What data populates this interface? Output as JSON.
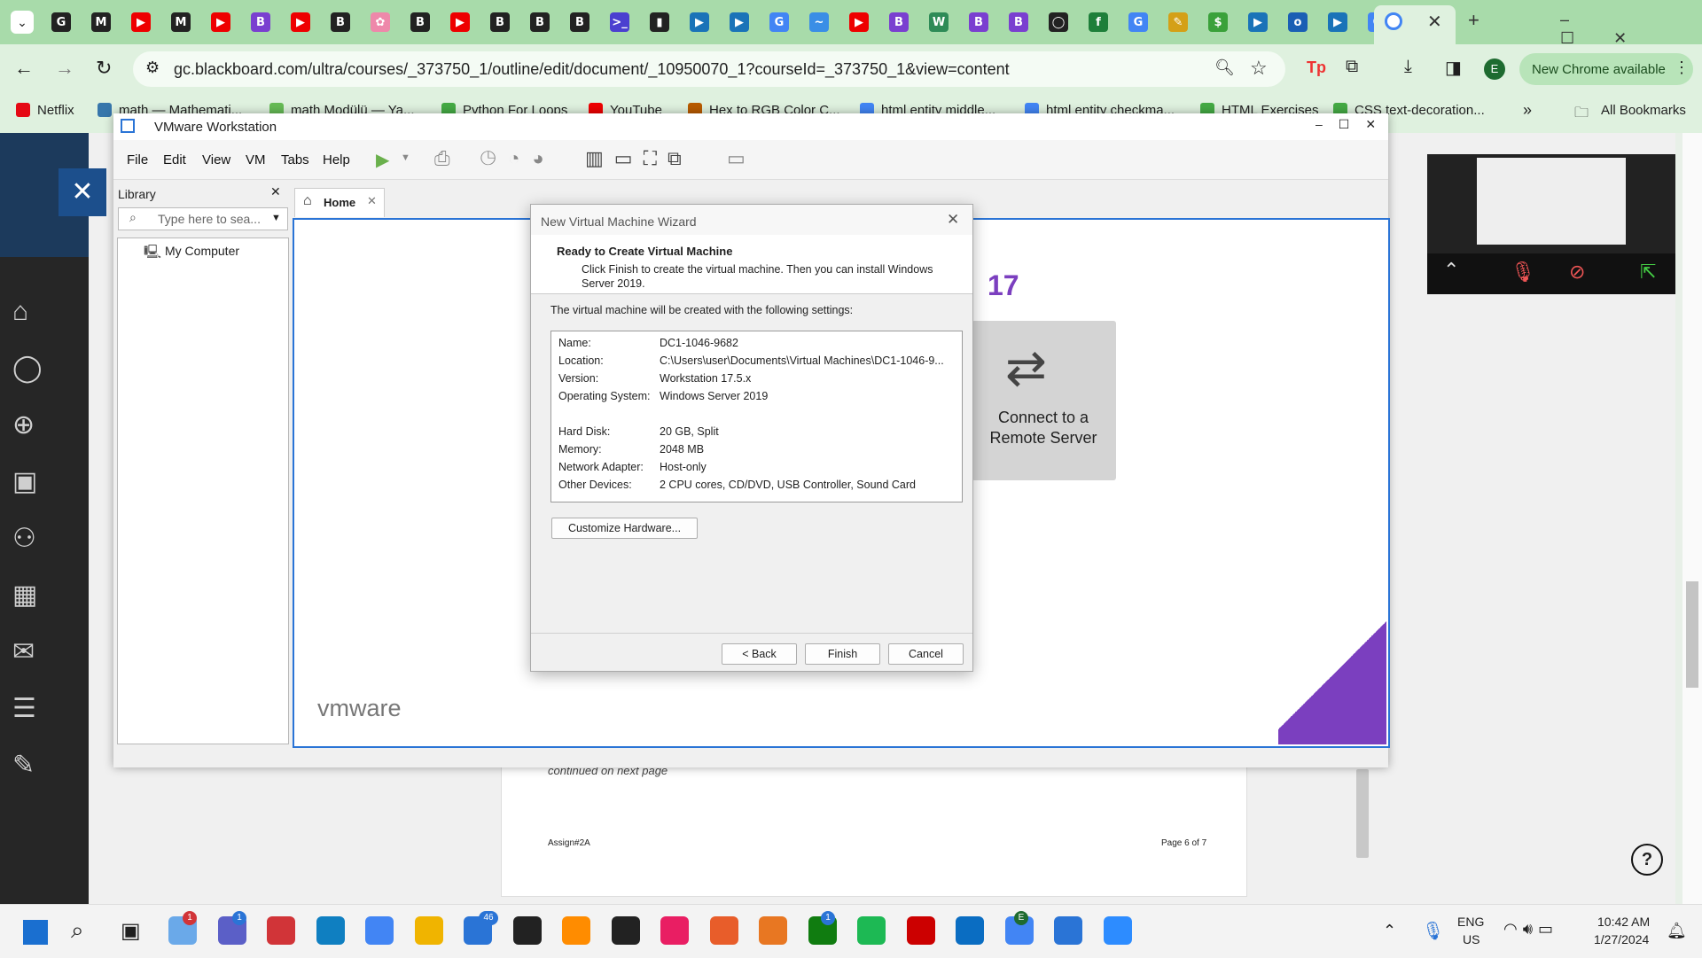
{
  "browser": {
    "url": "gc.blackboard.com/ultra/courses/_373750_1/outline/edit/document/_10950070_1?courseId=_373750_1&view=content",
    "update_label": "New Chrome available",
    "profile_initial": "E",
    "all_bookmarks_label": "All Bookmarks",
    "bookmarks": [
      {
        "label": "Netflix"
      },
      {
        "label": "math — Mathemati..."
      },
      {
        "label": "math Modülü — Ya..."
      },
      {
        "label": "Python For Loops"
      },
      {
        "label": "YouTube"
      },
      {
        "label": "Hex to RGB Color C..."
      },
      {
        "label": "html entity middle..."
      },
      {
        "label": "html entity checkma..."
      },
      {
        "label": "HTML Exercises"
      },
      {
        "label": "CSS text-decoration..."
      }
    ],
    "tab_icons": [
      "G",
      "M",
      "▶",
      "M",
      "▶",
      "B",
      "▶",
      "B",
      "✿",
      "B",
      "▶",
      "B",
      "B",
      "B",
      ">_",
      "▮",
      "▶",
      "▶",
      "G",
      "~",
      "▶",
      "B",
      "W",
      "B",
      "B",
      "◯",
      "f",
      "G",
      "✎",
      "$",
      "▶",
      "o",
      "▶",
      "G"
    ]
  },
  "vmware": {
    "title": "VMware Workstation",
    "menu": [
      "File",
      "Edit",
      "View",
      "VM",
      "Tabs",
      "Help"
    ],
    "library": {
      "title": "Library",
      "search_placeholder": "Type here to sea...",
      "tree_item": "My Computer"
    },
    "home_tab": "Home",
    "brand_version": "17",
    "connect_tile": "Connect to a Remote Server",
    "logo": "vmware"
  },
  "wizard": {
    "title": "New Virtual Machine Wizard",
    "heading": "Ready to Create Virtual Machine",
    "subheading": "Click Finish to create the virtual machine. Then you can install Windows Server 2019.",
    "intro": "The virtual machine will be created with the following settings:",
    "settings": [
      {
        "key": "Name:",
        "value": "DC1-1046-9682"
      },
      {
        "key": "Location:",
        "value": "C:\\Users\\user\\Documents\\Virtual Machines\\DC1-1046-9..."
      },
      {
        "key": "Version:",
        "value": "Workstation 17.5.x"
      },
      {
        "key": "Operating System:",
        "value": "Windows Server 2019"
      },
      {
        "key": "Hard Disk:",
        "value": "20 GB, Split"
      },
      {
        "key": "Memory:",
        "value": "2048 MB"
      },
      {
        "key": "Network Adapter:",
        "value": "Host-only"
      },
      {
        "key": "Other Devices:",
        "value": "2 CPU cores, CD/DVD, USB Controller, Sound Card"
      }
    ],
    "customize_label": "Customize Hardware...",
    "back_label": "< Back",
    "finish_label": "Finish",
    "cancel_label": "Cancel"
  },
  "document": {
    "continued": "continued on next page",
    "footer_left": "Assign#2A",
    "footer_right": "Page 6 of 7"
  },
  "taskbar": {
    "lang": "ENG",
    "region": "US",
    "time": "10:42 AM",
    "date": "1/27/2024",
    "badges": {
      "onedrive": "1",
      "teams": "1",
      "mail": "46",
      "xbox": "1",
      "chrome": "E"
    }
  },
  "colors": {
    "chrome_tabs": "#a8dbaa",
    "chrome_toolbar": "#dff1df",
    "vm_accent": "#7b3fbf",
    "selection": "#2a74d6"
  }
}
